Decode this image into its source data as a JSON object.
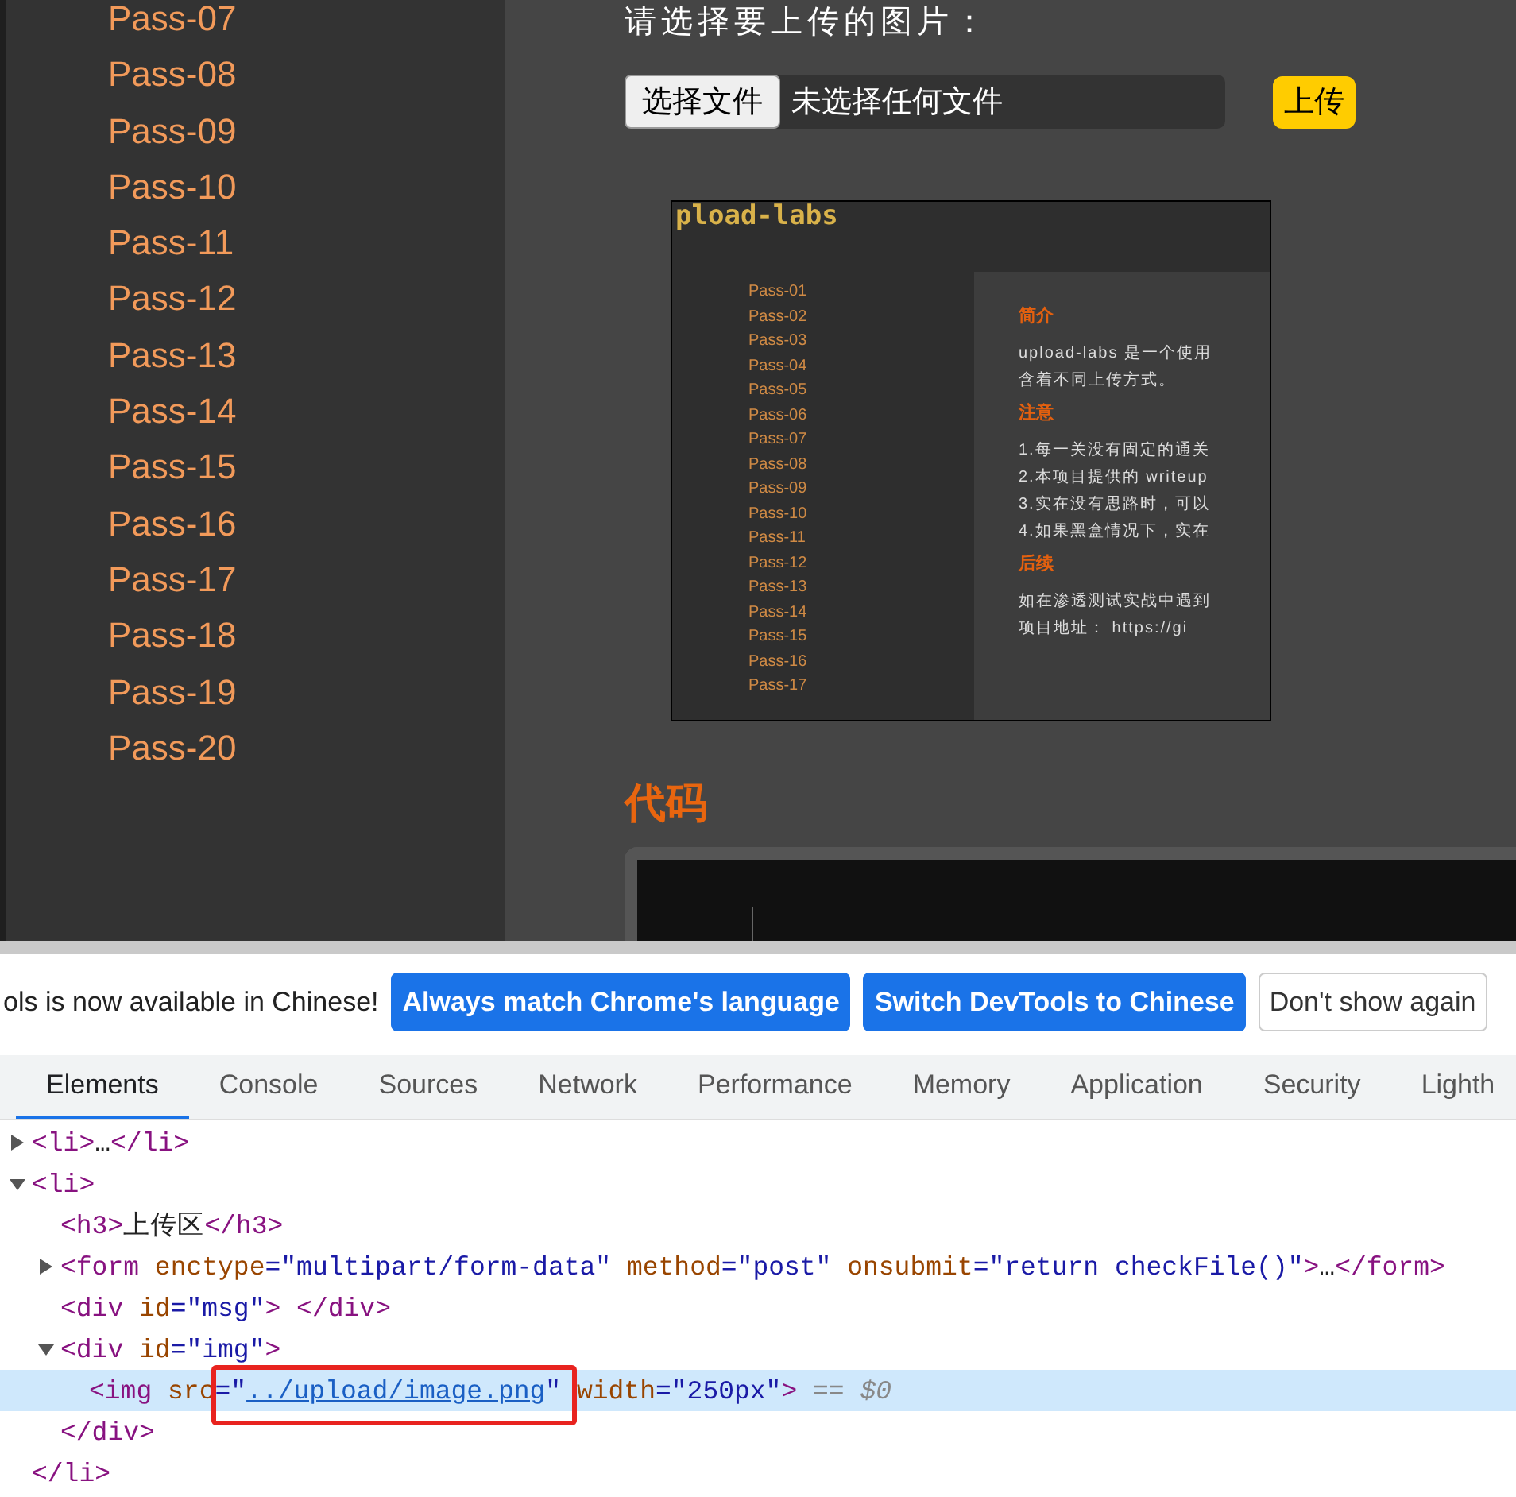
{
  "sidebar": {
    "items": [
      {
        "label": "Pass-07"
      },
      {
        "label": "Pass-08"
      },
      {
        "label": "Pass-09"
      },
      {
        "label": "Pass-10"
      },
      {
        "label": "Pass-11"
      },
      {
        "label": "Pass-12"
      },
      {
        "label": "Pass-13"
      },
      {
        "label": "Pass-14"
      },
      {
        "label": "Pass-15"
      },
      {
        "label": "Pass-16"
      },
      {
        "label": "Pass-17"
      },
      {
        "label": "Pass-18"
      },
      {
        "label": "Pass-19"
      },
      {
        "label": "Pass-20"
      }
    ]
  },
  "upload": {
    "prompt": "请选择要上传的图片：",
    "choose_button": "选择文件",
    "file_status": "未选择任何文件",
    "submit_button": "上传"
  },
  "preview": {
    "logo": "pload-labs",
    "nav": [
      "Pass-01",
      "Pass-02",
      "Pass-03",
      "Pass-04",
      "Pass-05",
      "Pass-06",
      "Pass-07",
      "Pass-08",
      "Pass-09",
      "Pass-10",
      "Pass-11",
      "Pass-12",
      "Pass-13",
      "Pass-14",
      "Pass-15",
      "Pass-16",
      "Pass-17"
    ],
    "sections": [
      {
        "heading": "简介",
        "lines": [
          "upload-labs 是一个使用",
          "含着不同上传方式。"
        ]
      },
      {
        "heading": "注意",
        "lines": [
          "1.每一关没有固定的通关",
          "2.本项目提供的 writeup",
          "3.实在没有思路时，可以",
          "4.如果黑盒情况下，实在"
        ]
      },
      {
        "heading": "后续",
        "lines": [
          "如在渗透测试实战中遇到",
          "项目地址： https://gi"
        ]
      }
    ]
  },
  "code_heading": "代码",
  "devtools": {
    "infobar": {
      "message": "ols is now available in Chinese!",
      "buttons": [
        {
          "label": "Always match Chrome's language",
          "kind": "primary"
        },
        {
          "label": "Switch DevTools to Chinese",
          "kind": "primary"
        },
        {
          "label": "Don't show again",
          "kind": "secondary"
        }
      ]
    },
    "tabs": [
      {
        "label": "Elements",
        "selected": true
      },
      {
        "label": "Console",
        "selected": false
      },
      {
        "label": "Sources",
        "selected": false
      },
      {
        "label": "Network",
        "selected": false
      },
      {
        "label": "Performance",
        "selected": false
      },
      {
        "label": "Memory",
        "selected": false
      },
      {
        "label": "Application",
        "selected": false
      },
      {
        "label": "Security",
        "selected": false
      },
      {
        "label": "Lighth",
        "selected": false
      }
    ],
    "tree": [
      {
        "selected": false,
        "expanded": false,
        "line": [
          {
            "kind": "tag",
            "text": "<li>"
          },
          {
            "kind": "text",
            "text": "…"
          },
          {
            "kind": "tag",
            "text": "</li>"
          }
        ]
      },
      {
        "selected": false,
        "expanded": true,
        "line": [
          {
            "kind": "tag",
            "text": "<li>"
          }
        ],
        "closing": [
          {
            "kind": "tag",
            "text": "</li>"
          }
        ],
        "children": [
          {
            "selected": false,
            "line": [
              {
                "kind": "tag",
                "text": "<h3>"
              },
              {
                "kind": "text",
                "text": "上传区"
              },
              {
                "kind": "tag",
                "text": "</h3>"
              }
            ]
          },
          {
            "selected": false,
            "expanded": false,
            "line": [
              {
                "kind": "tag",
                "text": "<form"
              },
              {
                "kind": "attr",
                "text": " enctype"
              },
              {
                "kind": "value",
                "text": "=\"multipart/form-data\""
              },
              {
                "kind": "attr",
                "text": " method"
              },
              {
                "kind": "value",
                "text": "=\"post\""
              },
              {
                "kind": "attr",
                "text": " onsubmit"
              },
              {
                "kind": "value",
                "text": "=\"return checkFile()\""
              },
              {
                "kind": "tag",
                "text": ">"
              },
              {
                "kind": "text",
                "text": "…"
              },
              {
                "kind": "tag",
                "text": "</form>"
              }
            ]
          },
          {
            "selected": false,
            "line": [
              {
                "kind": "tag",
                "text": "<div"
              },
              {
                "kind": "attr",
                "text": " id"
              },
              {
                "kind": "value",
                "text": "=\"msg\""
              },
              {
                "kind": "tag",
                "text": ">"
              },
              {
                "kind": "tag",
                "text": " </div>"
              }
            ]
          },
          {
            "selected": false,
            "expanded": true,
            "line": [
              {
                "kind": "tag",
                "text": "<div"
              },
              {
                "kind": "attr",
                "text": " id"
              },
              {
                "kind": "value",
                "text": "=\"img\""
              },
              {
                "kind": "tag",
                "text": ">"
              }
            ],
            "closing": [
              {
                "kind": "tag",
                "text": "</div>"
              }
            ],
            "children": [
              {
                "selected": true,
                "line": [
                  {
                    "kind": "tag",
                    "text": "<img"
                  },
                  {
                    "kind": "attr",
                    "text": " src"
                  },
                  {
                    "kind": "value",
                    "text": "=\""
                  },
                  {
                    "kind": "link",
                    "text": "../upload/image.png",
                    "annotated": true
                  },
                  {
                    "kind": "value",
                    "text": "\""
                  },
                  {
                    "kind": "attr",
                    "text": " width"
                  },
                  {
                    "kind": "value",
                    "text": "=\"250px\""
                  },
                  {
                    "kind": "tag",
                    "text": ">"
                  },
                  {
                    "kind": "hint",
                    "text": " == $0"
                  }
                ]
              }
            ]
          }
        ]
      }
    ]
  }
}
